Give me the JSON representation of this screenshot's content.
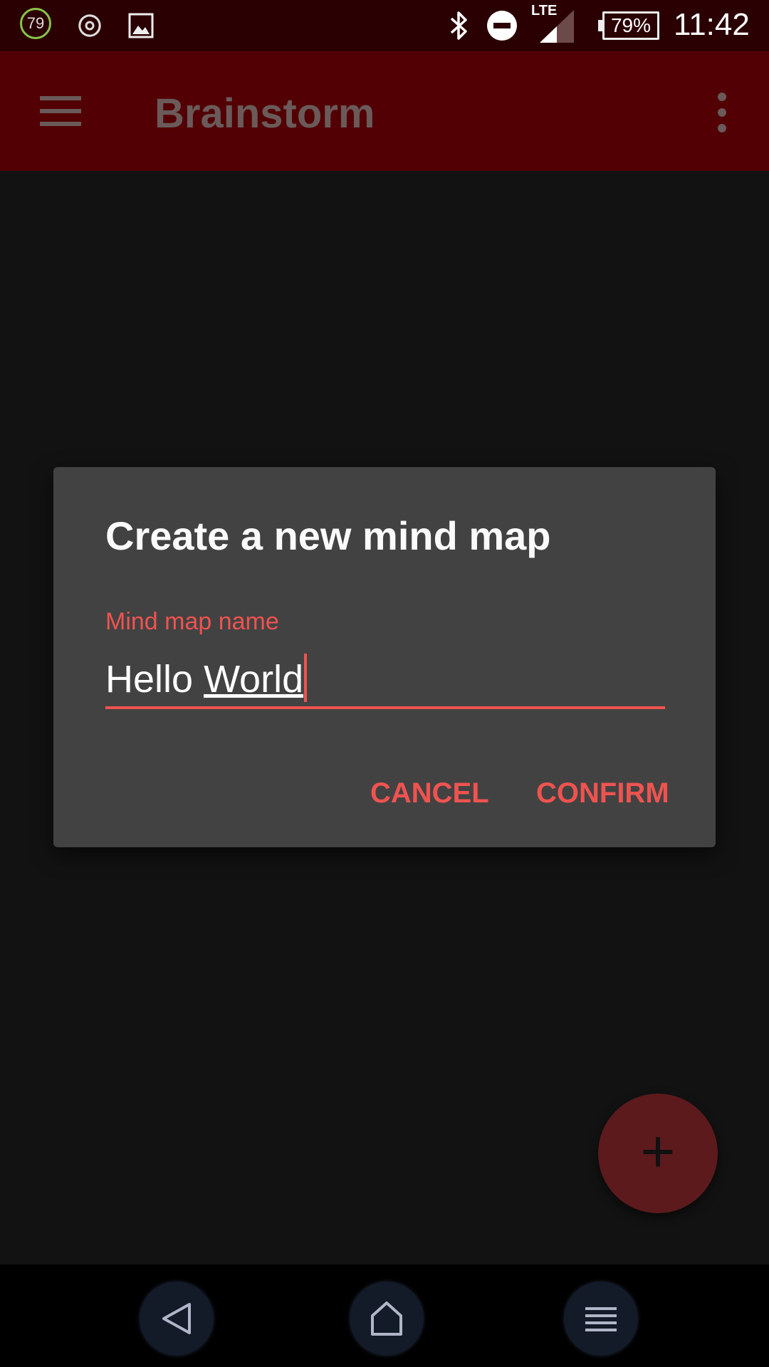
{
  "status_bar": {
    "ring_value": "79",
    "network_label": "LTE",
    "battery": "79%",
    "time": "11:42"
  },
  "app_bar": {
    "title": "Brainstorm"
  },
  "dialog": {
    "title": "Create a new mind map",
    "field_label": "Mind map name",
    "field_value_word1": "Hello ",
    "field_value_word2": "World",
    "cancel_label": "CANCEL",
    "confirm_label": "CONFIRM"
  },
  "fab": {
    "icon": "plus-icon",
    "glyph": "+"
  },
  "nav_bar": {
    "icons": [
      "back-icon",
      "home-icon",
      "recent-apps-icon"
    ]
  },
  "colors": {
    "accent": "#ef5350",
    "app_bar": "#520004",
    "status_bar": "#2a0003",
    "dialog": "#424242",
    "background": "#121212"
  }
}
